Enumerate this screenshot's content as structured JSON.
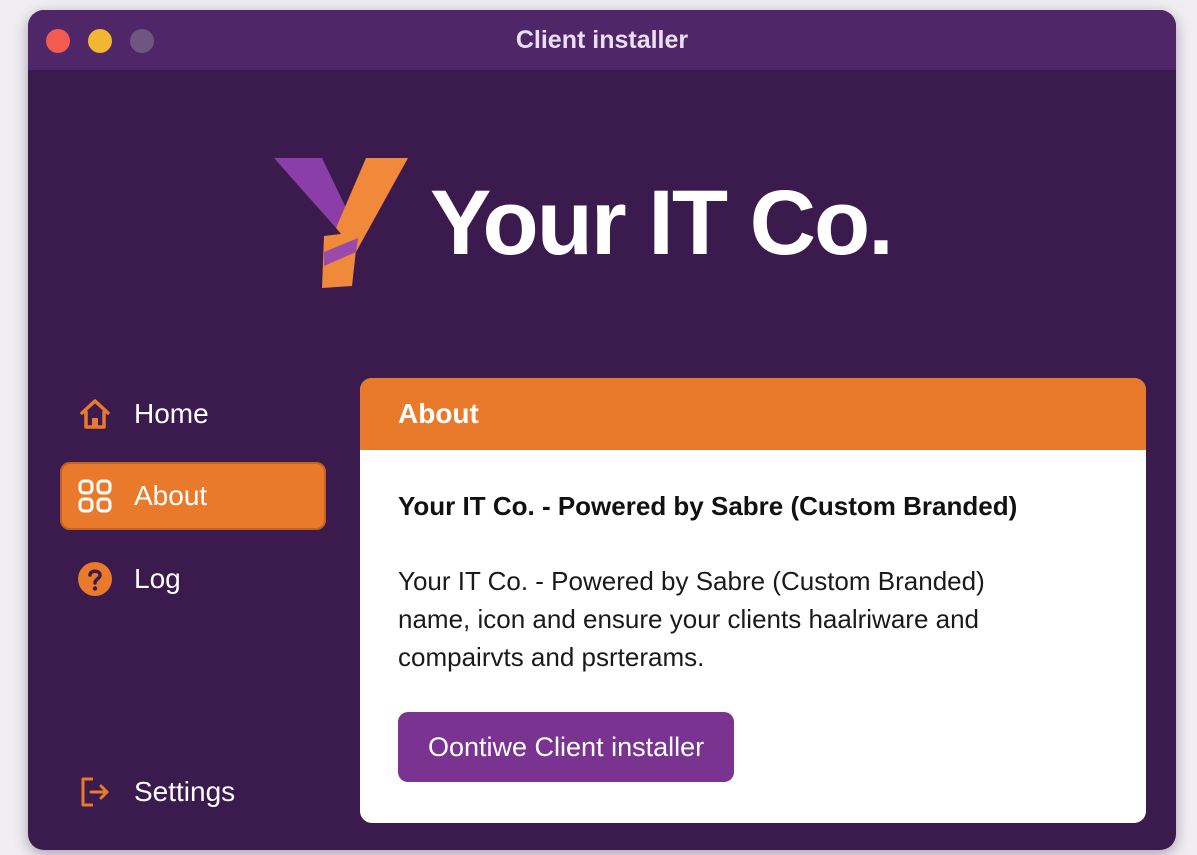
{
  "window": {
    "title": "Client installer",
    "controls": [
      "close",
      "minimize",
      "zoom"
    ]
  },
  "brand": {
    "logo_icon": "brand-y-logo",
    "name": "Your IT Co."
  },
  "sidebar": {
    "items": [
      {
        "label": "Home",
        "icon": "home-icon",
        "active": false
      },
      {
        "label": "About",
        "icon": "grid-icon",
        "active": true
      },
      {
        "label": "Log",
        "icon": "help-circle-icon",
        "active": false
      },
      {
        "label": "Settings",
        "icon": "exit-icon",
        "active": false
      }
    ]
  },
  "panel": {
    "header": "About",
    "heading": "Your IT Co. - Powered by Sabre (Custom Branded)",
    "body_lines": [
      "Your IT Co. - Powered by Sabre (Custom Branded)",
      "name, icon and ensure your clients haalriware and",
      "compairvts and psrterams."
    ],
    "button_label": "Oontiwe Client installer"
  },
  "colors": {
    "window_background": "#3b1a4e",
    "titlebar": "#4f2769",
    "accent_orange": "#ea7a2b",
    "accent_purple": "#7b3392",
    "panel_background": "#ffffff"
  }
}
